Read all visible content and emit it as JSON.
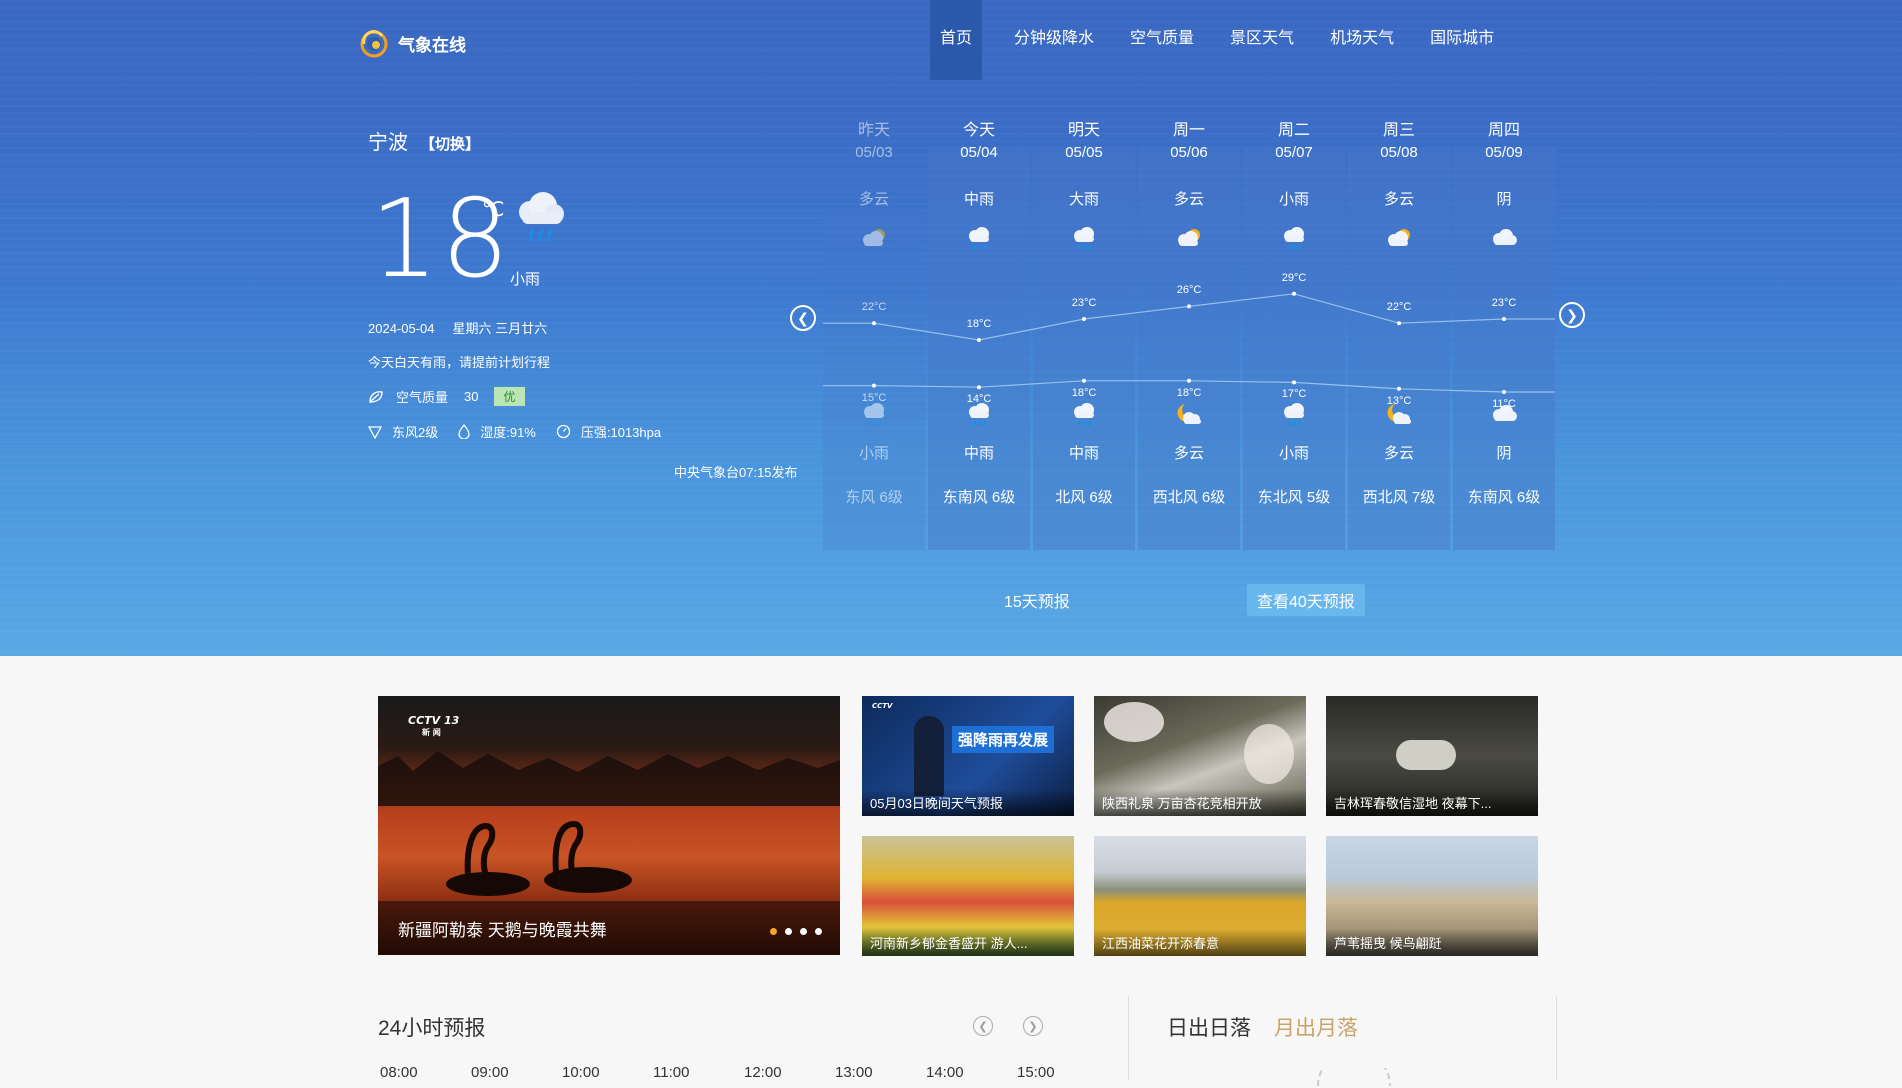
{
  "brand": {
    "name": "气象在线"
  },
  "nav": [
    {
      "label": "首页",
      "active": true
    },
    {
      "label": "分钟级降水"
    },
    {
      "label": "空气质量"
    },
    {
      "label": "景区天气"
    },
    {
      "label": "机场天气"
    },
    {
      "label": "国际城市"
    }
  ],
  "current": {
    "city": "宁波",
    "switch_label": "【切换】",
    "temperature": "18",
    "unit": "℃",
    "weather": "小雨",
    "date": "2024-05-04",
    "weekday_lunar": "星期六 三月廿六",
    "tip": "今天白天有雨，请提前计划行程",
    "air_quality_label": "空气质量",
    "air_quality_value": "30",
    "air_quality_level": "优",
    "wind": "东风2级",
    "humidity": "湿度:91%",
    "pressure": "压强:1013hpa",
    "publish": "中央气象台07:15发布"
  },
  "forecast": [
    {
      "day": "昨天",
      "date": "05/03",
      "day_weather": "多云",
      "day_icon": "partly-cloudy-icon",
      "high": 22,
      "high_label": "22°C",
      "low": 15,
      "low_label": "15°C",
      "night_icon": "rain-icon",
      "night_weather": "小雨",
      "wind": "东风 6级",
      "past": true
    },
    {
      "day": "今天",
      "date": "05/04",
      "day_weather": "中雨",
      "day_icon": "rain-icon",
      "high": 18,
      "high_label": "18°C",
      "low": 14,
      "low_label": "14°C",
      "night_icon": "rain-icon",
      "night_weather": "中雨",
      "wind": "东南风 6级"
    },
    {
      "day": "明天",
      "date": "05/05",
      "day_weather": "大雨",
      "day_icon": "rain-icon",
      "high": 23,
      "high_label": "23°C",
      "low": 18,
      "low_label": "18°C",
      "night_icon": "rain-icon",
      "night_weather": "中雨",
      "wind": "北风 6级"
    },
    {
      "day": "周一",
      "date": "05/06",
      "day_weather": "多云",
      "day_icon": "partly-cloudy-icon",
      "high": 26,
      "high_label": "26°C",
      "low": 18,
      "low_label": "18°C",
      "night_icon": "moon-cloud-icon",
      "night_weather": "多云",
      "wind": "西北风 6级"
    },
    {
      "day": "周二",
      "date": "05/07",
      "day_weather": "小雨",
      "day_icon": "rain-icon",
      "high": 29,
      "high_label": "29°C",
      "low": 17,
      "low_label": "17°C",
      "night_icon": "rain-icon",
      "night_weather": "小雨",
      "wind": "东北风 5级"
    },
    {
      "day": "周三",
      "date": "05/08",
      "day_weather": "多云",
      "day_icon": "partly-cloudy-icon",
      "high": 22,
      "high_label": "22°C",
      "low": 13,
      "low_label": "13°C",
      "night_icon": "moon-cloud-icon",
      "night_weather": "多云",
      "wind": "西北风 7级"
    },
    {
      "day": "周四",
      "date": "05/09",
      "day_weather": "阴",
      "day_icon": "cloud-icon",
      "high": 23,
      "high_label": "23°C",
      "low": 11,
      "low_label": "11°C",
      "night_icon": "cloud-icon",
      "night_weather": "阴",
      "wind": "东南风 6级"
    }
  ],
  "forecast_buttons": {
    "fifteen": "15天预报",
    "forty": "查看40天预报"
  },
  "media": {
    "big": {
      "caption": "新疆阿勒泰 天鹅与晚霞共舞",
      "logo": "CCTV 13",
      "logo_sub": "新 闻"
    },
    "thumbs": [
      {
        "caption": "05月03日晚间天气预报",
        "overlay": "强降雨再发展"
      },
      {
        "caption": "陕西礼泉 万亩杏花竞相开放"
      },
      {
        "caption": "吉林珲春敬信湿地 夜幕下..."
      },
      {
        "caption": "河南新乡郁金香盛开 游人..."
      },
      {
        "caption": "江西油菜花开添春意"
      },
      {
        "caption": "芦苇摇曳 候鸟翩跹"
      }
    ]
  },
  "hourly": {
    "title": "24小时预报",
    "hours": [
      "08:00",
      "09:00",
      "10:00",
      "11:00",
      "12:00",
      "13:00",
      "14:00",
      "15:00"
    ]
  },
  "sun": {
    "tab_sun": "日出日落",
    "tab_moon": "月出月落"
  }
}
